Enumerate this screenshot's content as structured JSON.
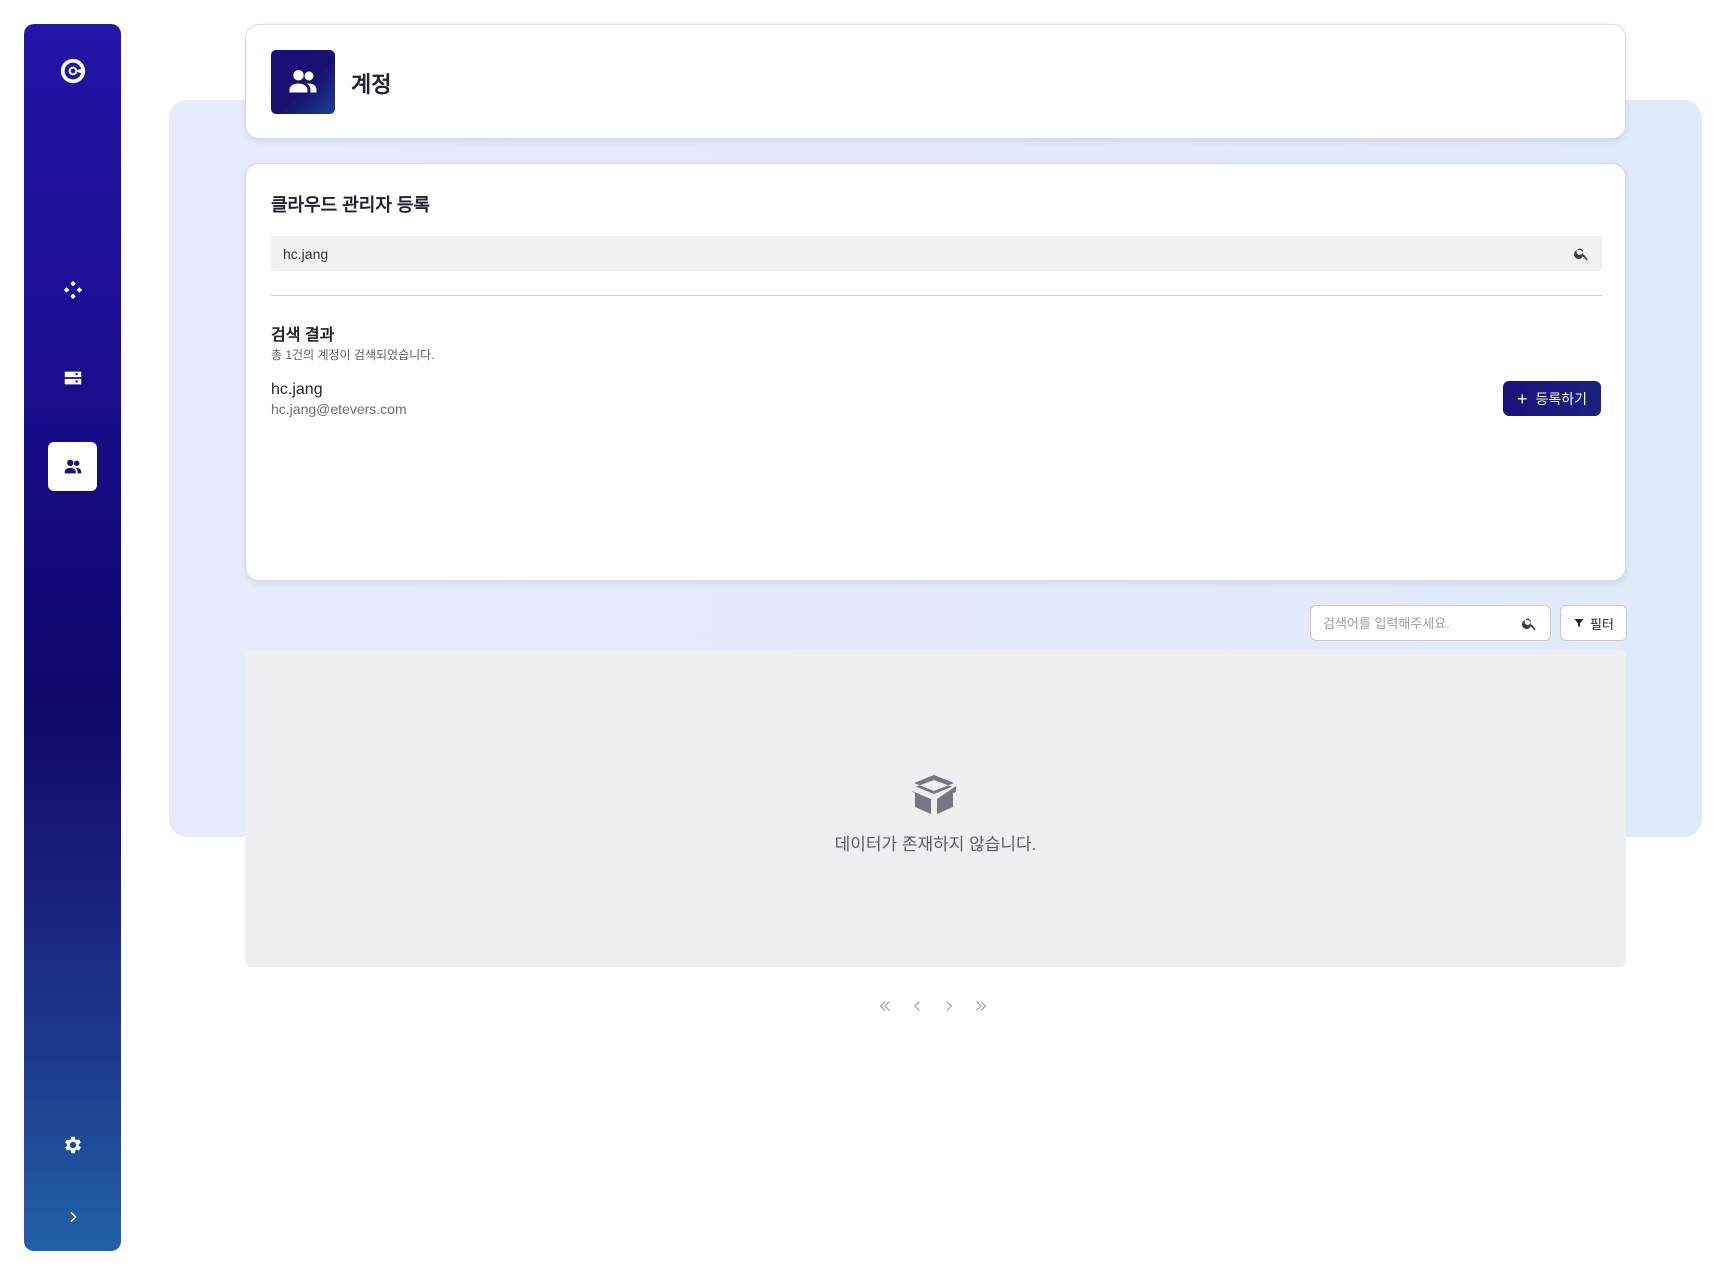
{
  "sidebar": {
    "items": [
      {
        "name": "logo",
        "icon": "logo-icon"
      },
      {
        "name": "nodes",
        "icon": "diagram-icon"
      },
      {
        "name": "servers",
        "icon": "server-icon"
      },
      {
        "name": "accounts",
        "icon": "users-icon",
        "active": true
      },
      {
        "name": "settings",
        "icon": "gear-icon"
      },
      {
        "name": "expand",
        "icon": "chevron-right-icon"
      }
    ],
    "colors": {
      "top": "#2414a8",
      "middle": "#10066a",
      "bottom": "#2361a8"
    }
  },
  "header": {
    "title": "계정",
    "icon": "users-icon"
  },
  "register_card": {
    "title": "클라우드 관리자 등록",
    "search_value": "hc.jang",
    "result_title": "검색 결과",
    "result_summary": "총 1건의 계정이 검색되었습니다.",
    "results": [
      {
        "name": "hc.jang",
        "email": "hc.jang@etevers.com"
      }
    ],
    "register_button_label": "등록하기"
  },
  "list": {
    "search_placeholder": "검색어를 입력해주세요.",
    "filter_label": "필터",
    "empty_message": "데이터가 존재하지 않습니다."
  },
  "pagination": {
    "first": "«",
    "prev": "‹",
    "next": "›",
    "last": "»"
  },
  "colors": {
    "accent": "#1a0f7c",
    "panel_bg": "#e8eafd",
    "table_bg": "#eeeff1"
  }
}
